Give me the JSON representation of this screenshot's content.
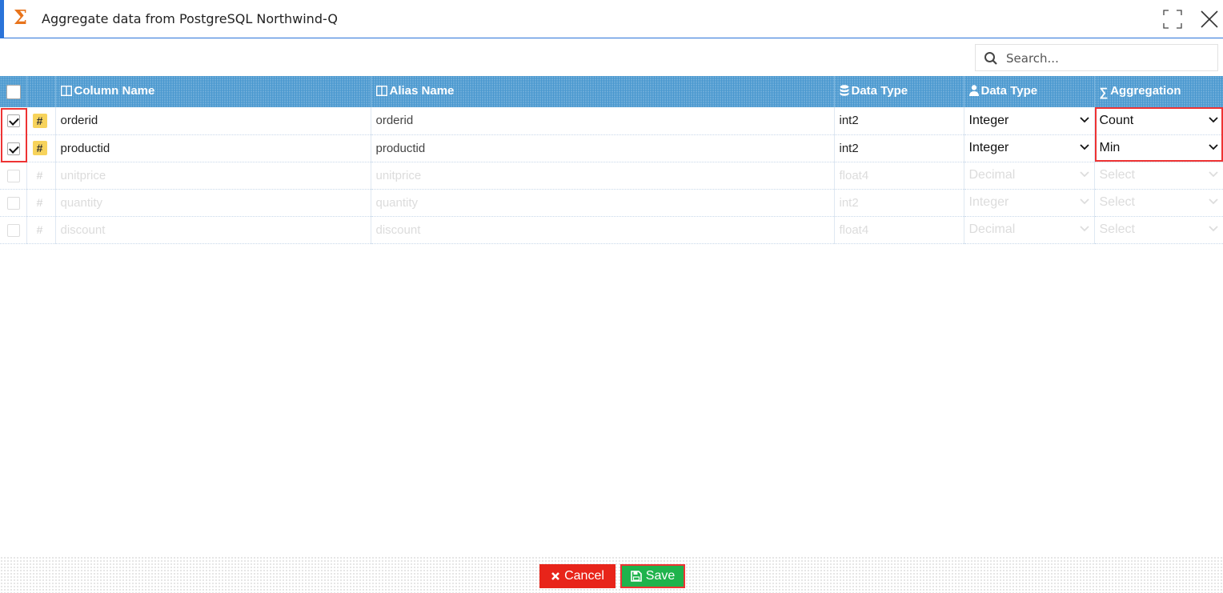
{
  "window": {
    "title": "Aggregate data from PostgreSQL Northwind-Q",
    "accent_color": "#2a73d9",
    "title_icon": "sigma-icon"
  },
  "search": {
    "placeholder": "Search..."
  },
  "table": {
    "headers": {
      "column_name": "Column Name",
      "alias_name": "Alias Name",
      "data_type_db": "Data Type",
      "data_type": "Data Type",
      "aggregation": "Aggregation"
    },
    "rows": [
      {
        "checked": true,
        "column_name": "orderid",
        "alias": "orderid",
        "db_type": "int2",
        "data_type": "Integer",
        "aggregation": "Count"
      },
      {
        "checked": true,
        "column_name": "productid",
        "alias": "productid",
        "db_type": "int2",
        "data_type": "Integer",
        "aggregation": "Min"
      },
      {
        "checked": false,
        "column_name": "unitprice",
        "alias": "unitprice",
        "db_type": "float4",
        "data_type": "Decimal",
        "aggregation": "Select"
      },
      {
        "checked": false,
        "column_name": "quantity",
        "alias": "quantity",
        "db_type": "int2",
        "data_type": "Integer",
        "aggregation": "Select"
      },
      {
        "checked": false,
        "column_name": "discount",
        "alias": "discount",
        "db_type": "float4",
        "data_type": "Decimal",
        "aggregation": "Select"
      }
    ]
  },
  "footer": {
    "cancel_label": "Cancel",
    "save_label": "Save",
    "cancel_color": "#e8241a",
    "save_color": "#1fb34c"
  }
}
